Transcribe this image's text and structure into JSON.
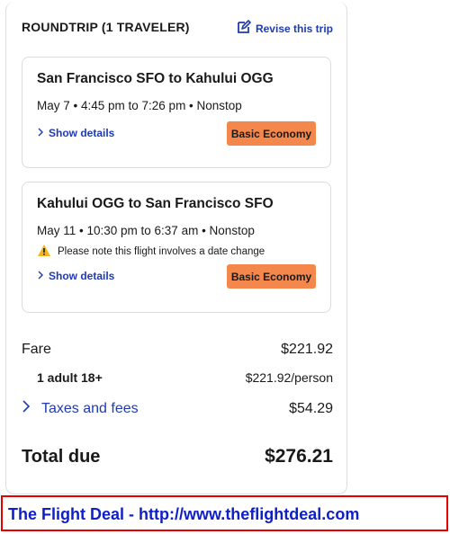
{
  "header": {
    "title": "ROUNDTRIP (1 TRAVELER)",
    "revise_label": "Revise this trip",
    "revise_icon": "edit-icon"
  },
  "flights": [
    {
      "route": "San Francisco SFO to Kahului OGG",
      "times": "May 7 • 4:45 pm to 7:26 pm • Nonstop",
      "details_label": "Show details",
      "fare_class": "Basic Economy"
    },
    {
      "route": "Kahului OGG to San Francisco SFO",
      "times": "May 11 • 10:30 pm to 6:37 am • Nonstop",
      "warning": "Please note this flight involves a date change",
      "details_label": "Show details",
      "fare_class": "Basic Economy"
    }
  ],
  "pricing": {
    "fare_label": "Fare",
    "fare_amount": "$221.92",
    "traveler_label": "1 adult 18+",
    "traveler_amount": "$221.92/person",
    "taxes_label": "Taxes and fees",
    "taxes_amount": "$54.29",
    "total_label": "Total due",
    "total_amount": "$276.21"
  },
  "footer": {
    "text": "The Flight Deal - http://www.theflightdeal.com"
  },
  "colors": {
    "link": "#1f3bb3",
    "badge": "#f4874b",
    "warning": "#f2b51c",
    "footer_border": "#e60000",
    "footer_text": "#1020c8"
  }
}
